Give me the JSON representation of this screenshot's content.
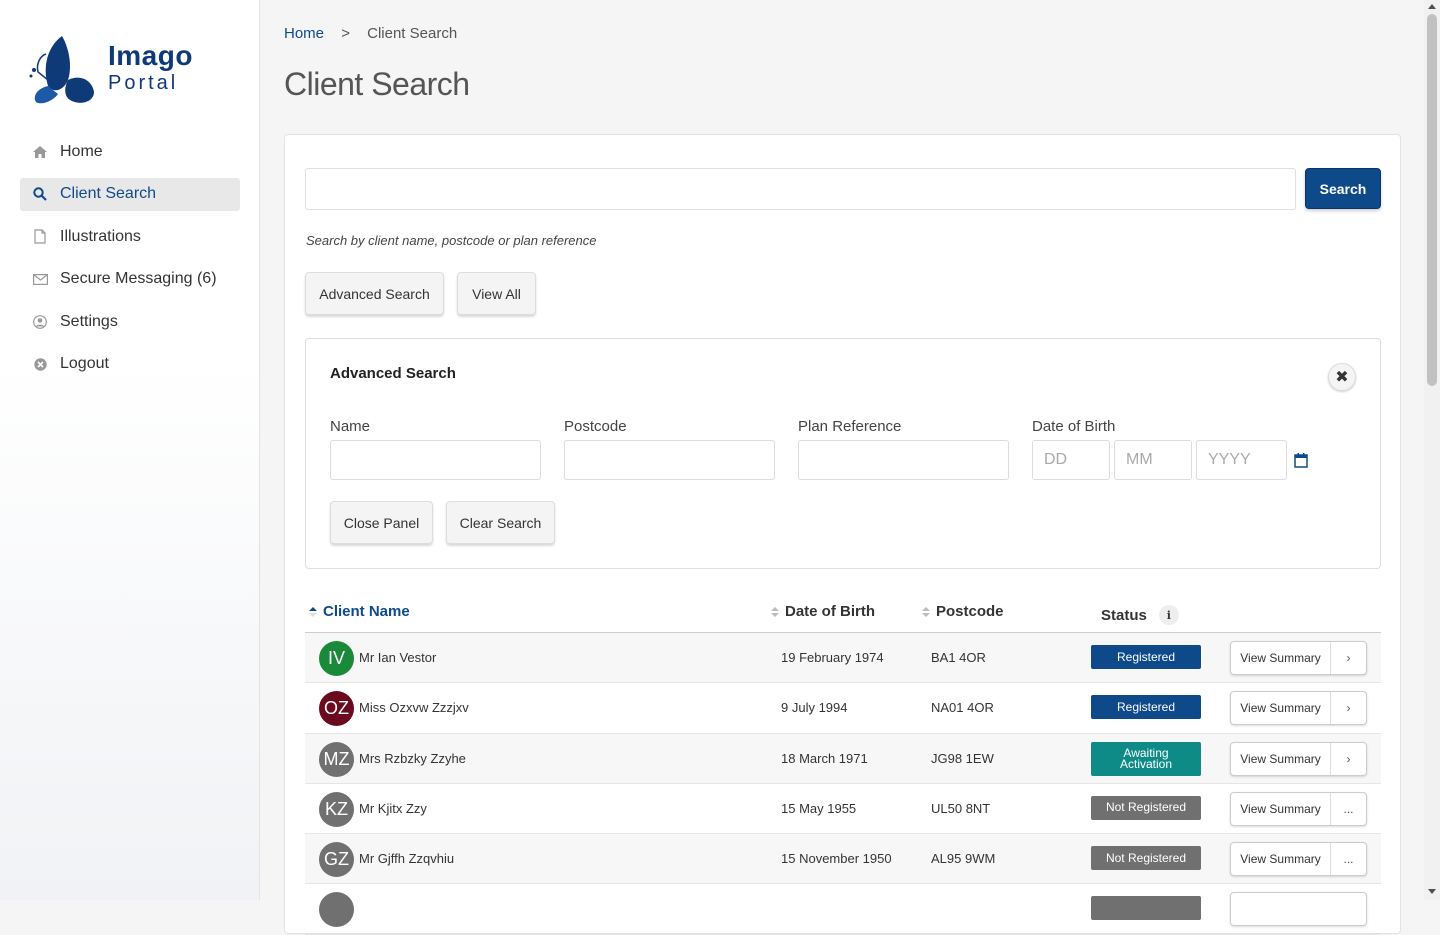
{
  "brand": {
    "title": "Imago",
    "subtitle": "Portal",
    "color": "#0e3a78"
  },
  "sidebar": {
    "items": [
      {
        "label": "Home",
        "icon": "home-icon",
        "active": false
      },
      {
        "label": "Client Search",
        "icon": "search-icon",
        "active": true
      },
      {
        "label": "Illustrations",
        "icon": "document-icon",
        "active": false
      },
      {
        "label": "Secure Messaging (6)",
        "icon": "envelope-icon",
        "active": false
      },
      {
        "label": "Settings",
        "icon": "user-circle-icon",
        "active": false
      },
      {
        "label": "Logout",
        "icon": "close-circle-icon",
        "active": false
      }
    ]
  },
  "breadcrumb": {
    "home": "Home",
    "separator": ">",
    "current": "Client Search"
  },
  "page": {
    "title": "Client Search"
  },
  "search": {
    "value": "",
    "button": "Search",
    "hint": "Search by client name, postcode or plan reference",
    "advanced_button": "Advanced Search",
    "view_all_button": "View All"
  },
  "advanced": {
    "title": "Advanced Search",
    "name_label": "Name",
    "postcode_label": "Postcode",
    "plan_label": "Plan Reference",
    "dob_label": "Date of Birth",
    "dd_placeholder": "DD",
    "mm_placeholder": "MM",
    "yyyy_placeholder": "YYYY",
    "close_panel": "Close Panel",
    "clear_search": "Clear Search"
  },
  "table": {
    "headers": {
      "name": "Client Name",
      "dob": "Date of Birth",
      "postcode": "Postcode",
      "status": "Status"
    },
    "rows": [
      {
        "initials": "IV",
        "color": "#1a8a3a",
        "name": "Mr Ian Vestor",
        "dob": "19 February 1974",
        "postcode": "BA1 4OR",
        "status": "Registered",
        "status_color": "#0e4a8a",
        "action": "View Summary",
        "extra": "›"
      },
      {
        "initials": "OZ",
        "color": "#6b0a1e",
        "name": "Miss Ozxvw Zzzjxv",
        "dob": "9 July 1994",
        "postcode": "NA01 4OR",
        "status": "Registered",
        "status_color": "#0e4a8a",
        "action": "View Summary",
        "extra": "›"
      },
      {
        "initials": "MZ",
        "color": "#707070",
        "name": "Mrs Rzbzky Zzyhe",
        "dob": "18 March 1971",
        "postcode": "JG98 1EW",
        "status": "Awaiting Activation",
        "status_color": "#0e8a87",
        "action": "View Summary",
        "extra": "›"
      },
      {
        "initials": "KZ",
        "color": "#707070",
        "name": "Mr Kjitx Zzy",
        "dob": "15 May 1955",
        "postcode": "UL50 8NT",
        "status": "Not Registered",
        "status_color": "#707070",
        "action": "View Summary",
        "extra": "..."
      },
      {
        "initials": "GZ",
        "color": "#707070",
        "name": "Mr Gjffh Zzqvhiu",
        "dob": "15 November 1950",
        "postcode": "AL95 9WM",
        "status": "Not Registered",
        "status_color": "#707070",
        "action": "View Summary",
        "extra": "..."
      }
    ]
  }
}
